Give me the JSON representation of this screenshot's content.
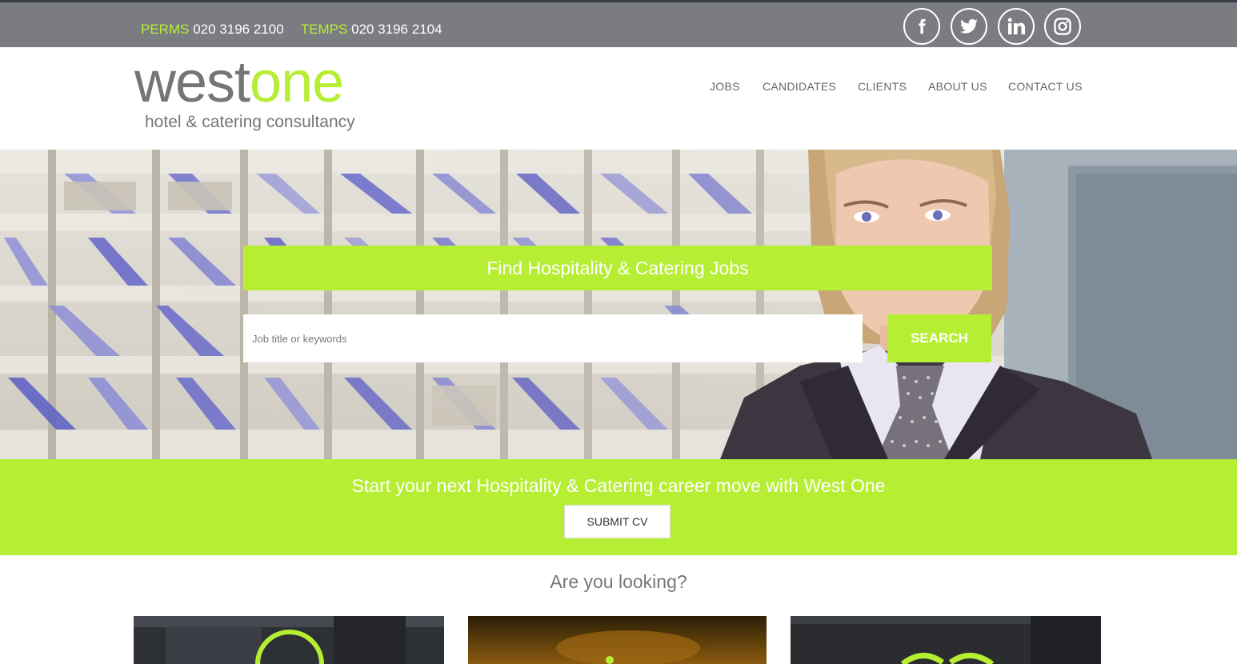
{
  "topbar": {
    "perms_label": "PERMS",
    "perms_phone": "020 3196 2100",
    "temps_label": "TEMPS",
    "temps_phone": "020 3196 2104",
    "social": [
      "facebook-icon",
      "twitter-icon",
      "linkedin-icon",
      "instagram-icon"
    ]
  },
  "logo": {
    "word_grey": "west",
    "word_green": "one",
    "subtitle": "hotel & catering consultancy"
  },
  "nav": {
    "items": [
      "JOBS",
      "CANDIDATES",
      "CLIENTS",
      "ABOUT US",
      "CONTACT US"
    ]
  },
  "hero": {
    "title": "Find Hospitality & Catering Jobs",
    "search_placeholder": "Job title or keywords",
    "search_button": "SEARCH"
  },
  "cta": {
    "text": "Start your next Hospitality & Catering career move with West One",
    "button": "SUBMIT CV"
  },
  "section": {
    "heading": "Are you looking?"
  },
  "colors": {
    "accent": "#b6ee34",
    "topbar": "#7b7c82",
    "text_grey": "#757575"
  }
}
